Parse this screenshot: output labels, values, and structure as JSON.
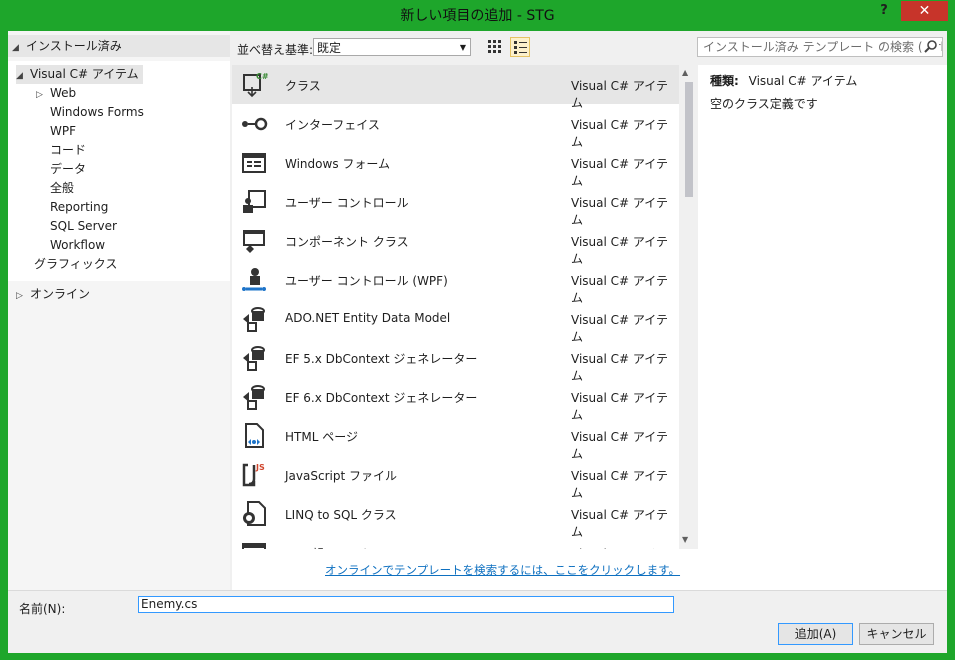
{
  "window": {
    "title": "新しい項目の追加 - STG",
    "help_label": "?",
    "close_label": "✕"
  },
  "left_tree": {
    "installed_header": "インストール済み",
    "nodes": [
      {
        "label": "Visual C# アイテム",
        "level": 1,
        "expanded": true,
        "selected": true
      },
      {
        "label": "Web",
        "level": 2,
        "expandable": true
      },
      {
        "label": "Windows Forms",
        "level": 2
      },
      {
        "label": "WPF",
        "level": 2
      },
      {
        "label": "コード",
        "level": 2
      },
      {
        "label": "データ",
        "level": 2
      },
      {
        "label": "全般",
        "level": 2
      },
      {
        "label": "Reporting",
        "level": 2
      },
      {
        "label": "SQL Server",
        "level": 2
      },
      {
        "label": "Workflow",
        "level": 2
      },
      {
        "label": "グラフィックス",
        "level": 1
      }
    ],
    "online_header": "オンライン"
  },
  "toolbar": {
    "sort_label": "並べ替え基準:",
    "sort_value": "既定"
  },
  "search": {
    "placeholder": "インストール済み テンプレート の検索 (Ctrl+E)"
  },
  "templates": [
    {
      "name": "クラス",
      "type": "Visual C# アイテム",
      "icon": "class-icon"
    },
    {
      "name": "インターフェイス",
      "type": "Visual C# アイテム",
      "icon": "interface-icon"
    },
    {
      "name": "Windows フォーム",
      "type": "Visual C# アイテム",
      "icon": "form-icon"
    },
    {
      "name": "ユーザー コントロール",
      "type": "Visual C# アイテム",
      "icon": "user-control-icon"
    },
    {
      "name": "コンポーネント クラス",
      "type": "Visual C# アイテム",
      "icon": "component-icon"
    },
    {
      "name": "ユーザー コントロール (WPF)",
      "type": "Visual C# アイテム",
      "icon": "wpf-user-control-icon"
    },
    {
      "name": "ADO.NET Entity Data Model",
      "type": "Visual C# アイテム",
      "icon": "entity-model-icon"
    },
    {
      "name": "EF 5.x DbContext ジェネレーター",
      "type": "Visual C# アイテム",
      "icon": "ef-generator-icon"
    },
    {
      "name": "EF 6.x DbContext ジェネレーター",
      "type": "Visual C# アイテム",
      "icon": "ef-generator-icon"
    },
    {
      "name": "HTML ページ",
      "type": "Visual C# アイテム",
      "icon": "html-page-icon"
    },
    {
      "name": "JavaScript ファイル",
      "type": "Visual C# アイテム",
      "icon": "javascript-icon"
    },
    {
      "name": "LINQ to SQL クラス",
      "type": "Visual C# アイテム",
      "icon": "linq-icon"
    },
    {
      "name": "MDI 親フォーム",
      "type": "Visual C# アイテム",
      "icon": "form-icon"
    }
  ],
  "online_link": "オンラインでテンプレートを検索するには、ここをクリックします。",
  "details": {
    "type_label": "種類:",
    "type_value": "Visual C# アイテム",
    "description": "空のクラス定義です"
  },
  "bottom": {
    "name_label": "名前(N):",
    "name_value": "Enemy.cs",
    "add_button": "追加(A)",
    "cancel_button": "キャンセル"
  }
}
